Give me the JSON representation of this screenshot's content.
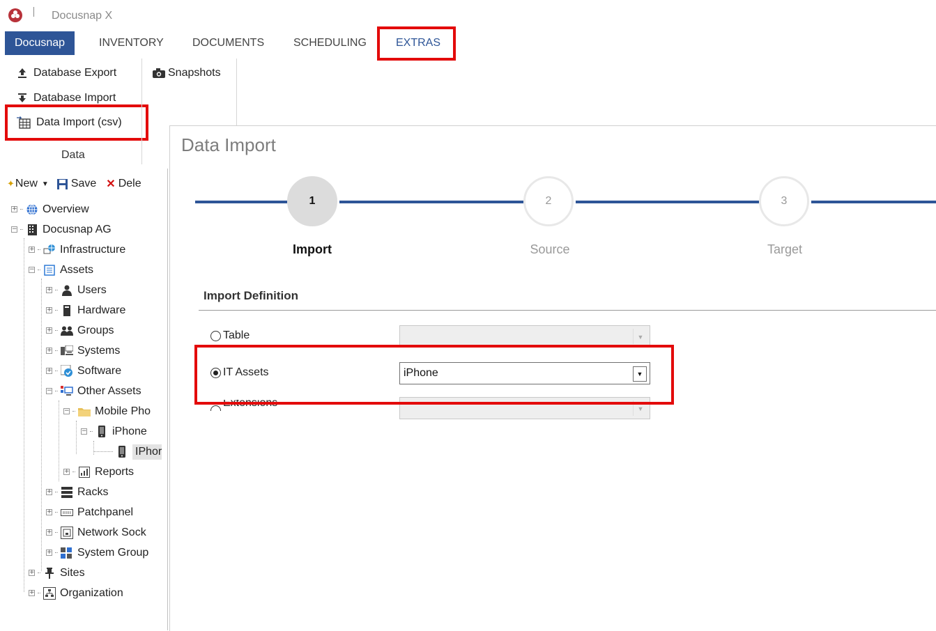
{
  "app": {
    "title": "Docusnap X"
  },
  "tabs": [
    "Docusnap",
    "INVENTORY",
    "DOCUMENTS",
    "SCHEDULING",
    "EXTRAS"
  ],
  "ribbon": {
    "data_group": {
      "items": [
        "Database Export",
        "Database Import",
        "Data Import (csv)"
      ],
      "label": "Data"
    },
    "snapshots": "Snapshots"
  },
  "toolbar": {
    "new": "New",
    "save": "Save",
    "delete": "Dele"
  },
  "tree": [
    "Overview",
    "Docusnap AG",
    "Infrastructure",
    "Assets",
    "Users",
    "Hardware",
    "Groups",
    "Systems",
    "Software",
    "Other Assets",
    "Mobile Pho",
    "iPhone",
    "IPhor",
    "Reports",
    "Racks",
    "Patchpanel",
    "Network Sock",
    "System Group",
    "Sites",
    "Organization"
  ],
  "dialog": {
    "title": "Data Import",
    "steps": [
      {
        "num": "1",
        "label": "Import"
      },
      {
        "num": "2",
        "label": "Source"
      },
      {
        "num": "3",
        "label": "Target"
      }
    ],
    "section": "Import Definition",
    "options": [
      {
        "label": "Table",
        "value": ""
      },
      {
        "label": "IT Assets",
        "value": "iPhone"
      },
      {
        "label": "Extensions",
        "value": ""
      }
    ],
    "selected_option": "IT Assets"
  },
  "colors": {
    "accent": "#2e5597",
    "highlight": "#e30b0b"
  }
}
